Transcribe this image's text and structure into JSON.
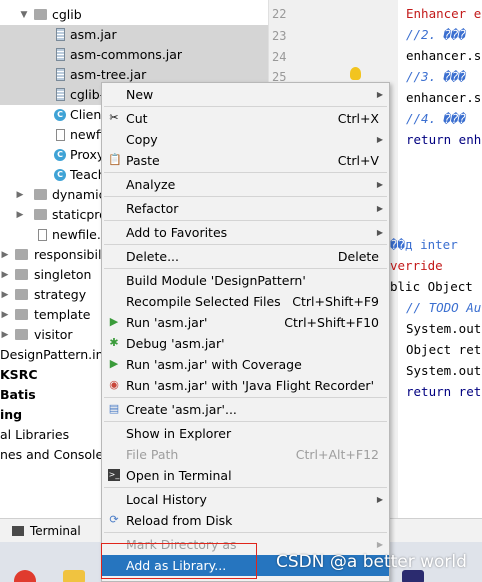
{
  "tree": {
    "items": [
      {
        "label": "cglib",
        "icon": "folder-icon"
      },
      {
        "label": "asm.jar",
        "icon": "jar-icon"
      },
      {
        "label": "asm-commons.jar",
        "icon": "jar-icon"
      },
      {
        "label": "asm-tree.jar",
        "icon": "jar-icon"
      },
      {
        "label": "cglib-",
        "icon": "jar-icon"
      },
      {
        "label": "Client",
        "icon": "class-icon"
      },
      {
        "label": "newfi",
        "icon": "file-icon"
      },
      {
        "label": "Proxy",
        "icon": "class-icon"
      },
      {
        "label": "Teach",
        "icon": "class-icon"
      },
      {
        "label": "dynamic",
        "icon": "folder-icon"
      },
      {
        "label": "staticpro",
        "icon": "folder-icon"
      },
      {
        "label": "newfile.c",
        "icon": "file-icon"
      },
      {
        "label": "responsibili",
        "icon": "folder-icon"
      },
      {
        "label": "singleton",
        "icon": "folder-icon"
      },
      {
        "label": "strategy",
        "icon": "folder-icon"
      },
      {
        "label": "template",
        "icon": "folder-icon"
      },
      {
        "label": "visitor",
        "icon": "folder-icon"
      },
      {
        "label": "DesignPattern.iml",
        "icon": "file-icon"
      },
      {
        "label": "KSRC",
        "icon": ""
      },
      {
        "label": "Batis",
        "icon": ""
      },
      {
        "label": "ing",
        "icon": ""
      },
      {
        "label": "al Libraries",
        "icon": ""
      },
      {
        "label": "nes and Consoles",
        "icon": ""
      }
    ]
  },
  "editor": {
    "line_numbers": [
      "22",
      "23",
      "24",
      "25"
    ],
    "lines": [
      "Enhancer e",
      "//2. ���",
      "enhancer.s",
      "//3. ���",
      "enhancer.s",
      "//4. ���",
      "return enh",
      "��д  inter",
      "verride",
      "blic Object",
      "// TODO Au",
      "System.out",
      "Object ret",
      "System.out",
      "return ret"
    ]
  },
  "menu": {
    "items": [
      {
        "label": "New",
        "shortcut": "",
        "submenu": true,
        "icon": ""
      },
      {
        "label": "Cut",
        "shortcut": "Ctrl+X",
        "submenu": false,
        "icon": "scissors-icon"
      },
      {
        "label": "Copy",
        "shortcut": "",
        "submenu": true,
        "icon": ""
      },
      {
        "label": "Paste",
        "shortcut": "Ctrl+V",
        "submenu": false,
        "icon": "clipboard-icon"
      },
      {
        "label": "Analyze",
        "shortcut": "",
        "submenu": true,
        "icon": ""
      },
      {
        "label": "Refactor",
        "shortcut": "",
        "submenu": true,
        "icon": ""
      },
      {
        "label": "Add to Favorites",
        "shortcut": "",
        "submenu": true,
        "icon": ""
      },
      {
        "label": "Delete...",
        "shortcut": "Delete",
        "submenu": false,
        "icon": ""
      },
      {
        "label": "Build Module 'DesignPattern'",
        "shortcut": "",
        "submenu": false,
        "icon": ""
      },
      {
        "label": "Recompile Selected Files",
        "shortcut": "Ctrl+Shift+F9",
        "submenu": false,
        "icon": ""
      },
      {
        "label": "Run 'asm.jar'",
        "shortcut": "Ctrl+Shift+F10",
        "submenu": false,
        "icon": "run-icon"
      },
      {
        "label": "Debug 'asm.jar'",
        "shortcut": "",
        "submenu": false,
        "icon": "debug-icon"
      },
      {
        "label": "Run 'asm.jar' with Coverage",
        "shortcut": "",
        "submenu": false,
        "icon": "coverage-icon"
      },
      {
        "label": "Run 'asm.jar' with 'Java Flight Recorder'",
        "shortcut": "",
        "submenu": false,
        "icon": "flight-recorder-icon"
      },
      {
        "label": "Create 'asm.jar'...",
        "shortcut": "",
        "submenu": false,
        "icon": "create-config-icon"
      },
      {
        "label": "Show in Explorer",
        "shortcut": "",
        "submenu": false,
        "icon": ""
      },
      {
        "label": "File Path",
        "shortcut": "Ctrl+Alt+F12",
        "submenu": false,
        "icon": ""
      },
      {
        "label": "Open in Terminal",
        "shortcut": "",
        "submenu": false,
        "icon": "terminal-icon"
      },
      {
        "label": "Local History",
        "shortcut": "",
        "submenu": true,
        "icon": ""
      },
      {
        "label": "Reload from Disk",
        "shortcut": "",
        "submenu": false,
        "icon": "reload-icon"
      },
      {
        "label": "Mark Directory as",
        "shortcut": "",
        "submenu": true,
        "icon": ""
      },
      {
        "label": "Add as Library...",
        "shortcut": "",
        "submenu": false,
        "icon": ""
      }
    ]
  },
  "bottom": {
    "terminal_tab": "Terminal"
  },
  "watermark": "CSDN @a better world",
  "colors": {
    "menu_highlight": "#2675bf",
    "selection_row": "#d5d5d5",
    "annotation_box": "#e0251b",
    "comment": "#3b6fd0",
    "keyword": "#000080",
    "string_red": "#c31a1a"
  }
}
